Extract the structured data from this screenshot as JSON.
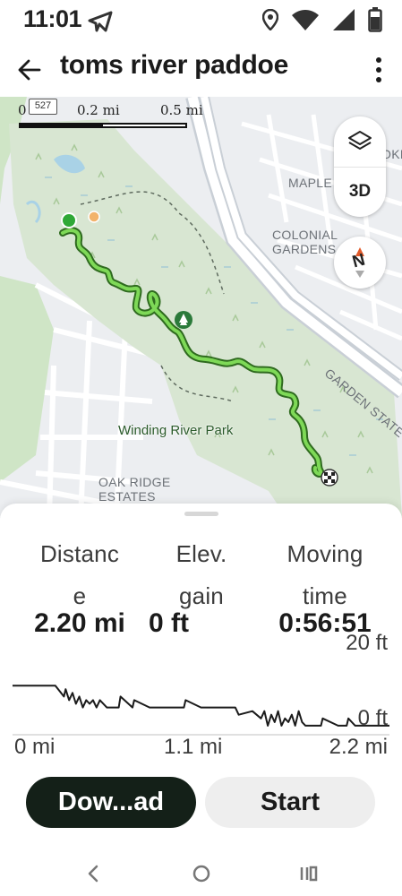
{
  "status_bar": {
    "time": "11:01",
    "icons": [
      "telegram-icon",
      "location-icon",
      "wifi-icon",
      "signal-icon",
      "battery-icon"
    ]
  },
  "header": {
    "title": "toms river paddoe",
    "back_icon": "arrow-left-icon",
    "more_icon": "more-vertical-icon"
  },
  "map": {
    "scale": {
      "zero": "0",
      "mid": "0.2 mi",
      "end": "0.5 mi"
    },
    "road_shield": "527",
    "labels": {
      "maple": "MAPLE",
      "colonial": "COLONIAL\nGARDENS",
      "garden_state": "GARDEN STATE",
      "oak_ridge": "OAK RIDGE\nESTATES",
      "oke": "OKE",
      "park": "Winding River Park"
    },
    "controls": {
      "layers_icon": "layers-icon",
      "three_d": "3D",
      "compass_label": "N"
    },
    "colors": {
      "route": "#7ed957",
      "route_outline": "#2f6b1f",
      "park": "#d8e6d2"
    }
  },
  "stats": {
    "distance": {
      "label_line1": "Distanc",
      "label_line2": "e",
      "value": "2.20 mi"
    },
    "elevation": {
      "label_line1": "Elev.",
      "label_line2": "gain",
      "value": "0 ft"
    },
    "moving": {
      "label_line1": "Moving",
      "label_line2": "time",
      "value": "0:56:51"
    }
  },
  "chart_data": {
    "type": "line",
    "title": "",
    "xlabel": "",
    "ylabel": "",
    "ylim": [
      0,
      20
    ],
    "xlim": [
      0,
      2.2
    ],
    "y_ticks": [
      "20 ft",
      "0 ft"
    ],
    "x_ticks": [
      "0 mi",
      "1.1 mi",
      "2.2 mi"
    ],
    "series": [
      {
        "x": [
          0,
          0.25,
          0.3,
          0.31,
          0.33,
          0.35,
          0.37,
          0.39,
          0.41,
          0.43,
          0.45,
          0.47,
          0.49,
          0.51,
          0.55,
          0.62,
          0.63,
          0.7,
          0.71,
          0.8,
          0.9,
          1.0,
          1.01,
          1.1,
          1.2,
          1.3,
          1.32,
          1.4,
          1.45,
          1.47,
          1.49,
          1.51,
          1.53,
          1.55,
          1.57,
          1.59,
          1.61,
          1.63,
          1.65,
          1.67,
          1.69,
          1.71,
          1.8,
          1.81,
          1.9,
          1.95,
          1.96,
          2.0,
          2.05,
          2.2
        ],
        "y": [
          12,
          12,
          9,
          11,
          8,
          10,
          7,
          9,
          6,
          8,
          7,
          8,
          6,
          8,
          6,
          6,
          9,
          6,
          8,
          6,
          6,
          6,
          8,
          6,
          6,
          6,
          4,
          5,
          3,
          5,
          1,
          4,
          2,
          5,
          1,
          3,
          2,
          4,
          1,
          5,
          2,
          1,
          1,
          3,
          1,
          1,
          3,
          1,
          1,
          1
        ]
      }
    ]
  },
  "actions": {
    "download": "Dow...ad",
    "start": "Start"
  },
  "navbar": {
    "back": "nav-back-icon",
    "home": "nav-home-icon",
    "recents": "nav-recents-icon"
  }
}
